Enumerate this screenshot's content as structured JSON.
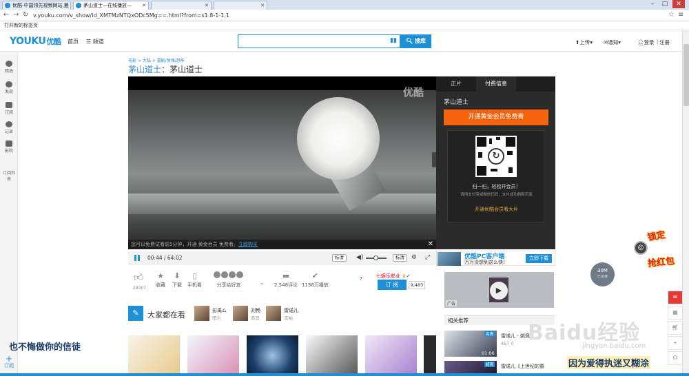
{
  "browser": {
    "tabs": [
      {
        "label": "优酷-中国领先视频网站,提",
        "active": false
      },
      {
        "label": "茅山道士—在线播放—",
        "active": true
      },
      {
        "label": "",
        "active": false
      },
      {
        "label": "",
        "active": false
      }
    ],
    "url": "v.youku.com/v_show/id_XMTMzNTQxODc5Mg==.html?from=s1.8-1-1.1",
    "bookmark": "打开新的标签页"
  },
  "header": {
    "logo_youku": "YOUKU",
    "logo_cn": "优酷",
    "nav_home": "首页",
    "nav_channel": "频道",
    "search_value": "",
    "search_button": "搜库",
    "upload": "上传",
    "notify": "通知",
    "login": "登录",
    "register": "注册"
  },
  "leftbar": {
    "items": [
      "精选",
      "发现",
      "订阅",
      "记录",
      "影院",
      "订阅列表"
    ],
    "add_label": "订阅"
  },
  "breadcrumb": "电影 > 大陆 > 喜剧/惊悚/恐怖",
  "title": {
    "main": "茅山道士",
    "sep": "：",
    "episode": "茅山道士"
  },
  "player": {
    "watermark": "优酷",
    "free_notice": "您可以免费试看前5分钟，开通 黄金会员 免费看。",
    "free_link": "立即购买",
    "time": "00:44 / 64:02",
    "quality": "标清",
    "volume_label": "标清"
  },
  "paypanel": {
    "tab_feature": "正片",
    "tab_pay": "付费信息",
    "title": "茅山道士",
    "vip_button": "开通黄金会员免费看",
    "scan_text": "扫一扫，轻松开会员！",
    "scan_sub": "请用支付宝或微信扫码，支付成功刷新页面",
    "pay_link": "开通优酷会员看大片"
  },
  "pc_ad": {
    "title": "优酷PC客户端",
    "subtitle": "万万没想到这么快!",
    "button": "立即下载"
  },
  "actions": {
    "like_count": "28307",
    "favorite": "收藏",
    "download": "下载",
    "mobile": "手机看",
    "share": "分享给好友",
    "comments": "2,548评论",
    "plays": "1138万播放",
    "uploader": "七娱乐影业",
    "subscribe": "订 阅",
    "sub_count": "9,483"
  },
  "everybody": {
    "title": "大家都在看",
    "people": [
      {
        "name": "彭禺厶",
        "role": "阳六"
      },
      {
        "name": "刘畅",
        "role": "赤显"
      },
      {
        "name": "雷诺儿",
        "role": "泽柏"
      }
    ]
  },
  "related": {
    "header": "相关推荐",
    "ad_tag": "广告",
    "items": [
      {
        "tag": "高清",
        "title": "雷诺儿 - 姚佩",
        "meta": "457  0",
        "duration": "01:06"
      },
      {
        "tag": "超清",
        "title": "雷诺儿《上世纪的童",
        "meta": "",
        "duration": ""
      }
    ]
  },
  "floating": {
    "speed": "30M",
    "speed_sub": "已加速",
    "promo_line1": "锁定",
    "promo_line2": "抢红包"
  },
  "overlay": {
    "caption_left": "也不悔做你的信徒",
    "caption_right": "因为爱得执迷又糊涂",
    "baidu": "Baidu经验",
    "baidu_sub": "jingyan.baidu.com"
  },
  "colors": {
    "accent": "#1f8fd6",
    "vip_orange": "#f5640c",
    "brand_red": "#e60012"
  }
}
